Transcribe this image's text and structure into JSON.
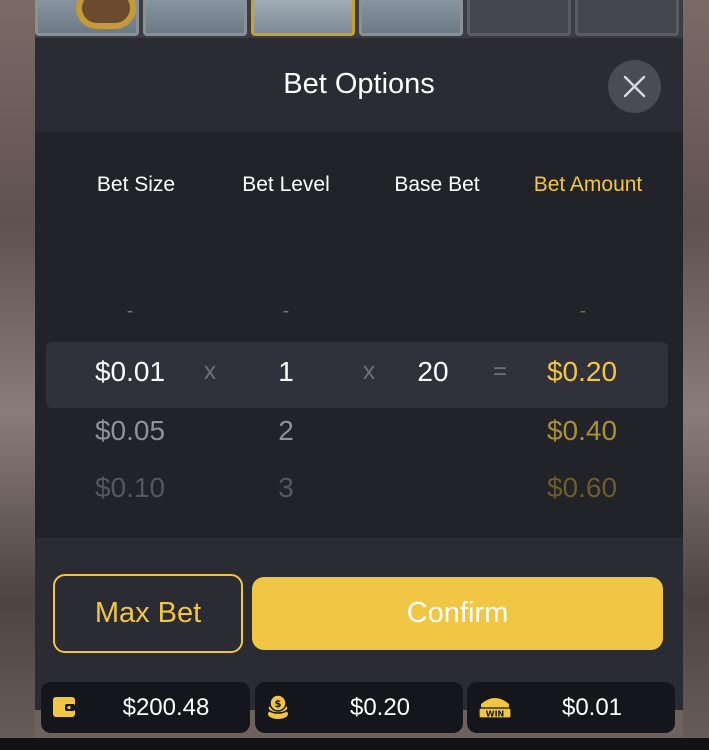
{
  "dialog": {
    "title": "Bet Options",
    "close_icon": "close-icon"
  },
  "columns": {
    "bet_size": "Bet Size",
    "bet_level": "Bet Level",
    "base_bet": "Base Bet",
    "bet_amount": "Bet Amount"
  },
  "placeholder_dash": "-",
  "operators": {
    "multiply": "x",
    "equals": "="
  },
  "rows": [
    {
      "bet_size": "$0.01",
      "bet_level": "1",
      "base_bet": "20",
      "bet_amount": "$0.20",
      "selected": true
    },
    {
      "bet_size": "$0.05",
      "bet_level": "2",
      "bet_amount": "$0.40",
      "selected": false
    },
    {
      "bet_size": "$0.10",
      "bet_level": "3",
      "bet_amount": "$0.60",
      "selected": false
    }
  ],
  "buttons": {
    "max_bet": "Max Bet",
    "confirm": "Confirm"
  },
  "status_bar": {
    "balance": {
      "icon": "wallet-icon",
      "value": "$200.48"
    },
    "bet": {
      "icon": "coin-stack-icon",
      "value": "$0.20"
    },
    "win": {
      "icon": "win-badge-icon",
      "value": "$0.01",
      "badge_text": "WIN"
    }
  },
  "colors": {
    "accent": "#f1c644",
    "panel": "#2a2b33",
    "picker": "#222329",
    "selected_row": "#30313b",
    "status_pill": "#15161b"
  }
}
